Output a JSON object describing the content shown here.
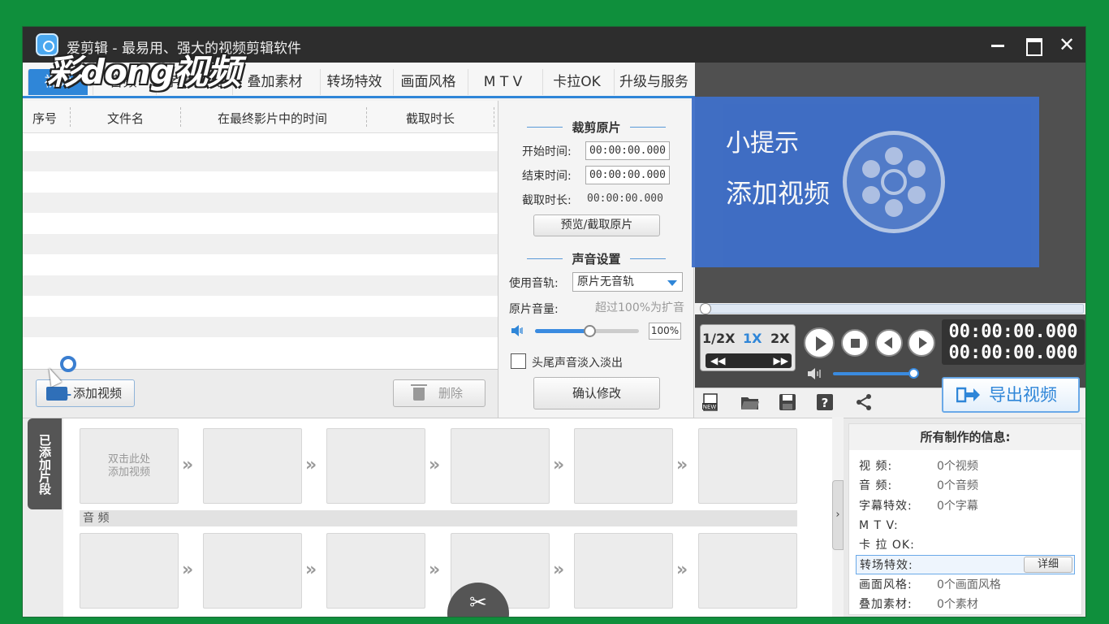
{
  "watermark": "彩dong视频",
  "window": {
    "title": "爱剪辑 - 最易用、强大的视频剪辑软件",
    "minimize_icon": "minimize-icon",
    "maximize_icon": "maximize-icon",
    "close_label": "✕"
  },
  "tabs": [
    {
      "label": "视频",
      "active": true
    },
    {
      "label": "音频"
    },
    {
      "label": "字幕特效"
    },
    {
      "label": "叠加素材"
    },
    {
      "label": "转场特效"
    },
    {
      "label": "画面风格"
    },
    {
      "label": "M T V"
    },
    {
      "label": "卡拉OK"
    },
    {
      "label": "升级与服务"
    }
  ],
  "filelist": {
    "columns": [
      "序号",
      "文件名",
      "在最终影片中的时间",
      "截取时长"
    ],
    "add_button": "添加视频",
    "delete_button": "删除"
  },
  "trim": {
    "title": "裁剪原片",
    "start_label": "开始时间:",
    "start_value": "00:00:00.000",
    "end_label": "结束时间:",
    "end_value": "00:00:00.000",
    "duration_label": "截取时长:",
    "duration_value": "00:00:00.000",
    "preview_button": "预览/截取原片"
  },
  "audio": {
    "title": "声音设置",
    "track_label": "使用音轨:",
    "track_value": "原片无音轨",
    "volume_label": "原片音量:",
    "volume_hint": "超过100%为扩音",
    "volume_value": "100%",
    "volume_level": 0.52,
    "fade_label": "头尾声音淡入淡出",
    "fade_checked": false,
    "confirm_button": "确认修改"
  },
  "tip": {
    "title": "小提示",
    "text": "添加视频"
  },
  "player": {
    "speeds": [
      "1/2X",
      "1X",
      "2X"
    ],
    "active_speed": "1X",
    "rewind": "◀◀",
    "forward": "▶▶",
    "time_current": "00:00:00.000",
    "time_total": "00:00:00.000",
    "player_volume_level": 1.0,
    "export_button": "导出视频"
  },
  "toolbar_icons": [
    "new-project-icon",
    "open-folder-icon",
    "save-icon",
    "help-icon",
    "share-icon"
  ],
  "toolbar_labels": {
    "new": "NEW",
    "help": "?"
  },
  "clips": {
    "side_tab": "已添加片段",
    "add_hint_line1": "双击此处",
    "add_hint_line2": "添加视频",
    "audio_label": "音 频",
    "arrow": "»",
    "cut_icon": "✂"
  },
  "info": {
    "title": "所有制作的信息:",
    "rows": [
      {
        "k": "视 频:",
        "v": "0个视频"
      },
      {
        "k": "音 频:",
        "v": "0个音频"
      },
      {
        "k": "字幕特效:",
        "v": "0个字幕"
      },
      {
        "k": "M T V:",
        "v": ""
      },
      {
        "k": "卡 拉 OK:",
        "v": ""
      },
      {
        "k": "转场特效:",
        "v": ""
      },
      {
        "k": "画面风格:",
        "v": "0个画面风格"
      },
      {
        "k": "叠加素材:",
        "v": "0个素材"
      }
    ],
    "detail_button": "详细"
  },
  "colors": {
    "accent": "#2f86d8",
    "background": "#0f8f3c",
    "tip_box": "#3f6fc8"
  }
}
